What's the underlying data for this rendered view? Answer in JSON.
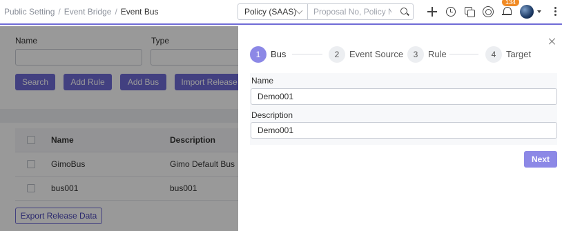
{
  "header": {
    "breadcrumb": [
      "Public Setting",
      "Event Bridge",
      "Event Bus"
    ],
    "breadcrumb_separator": "/",
    "policy_select": {
      "value": "Policy (SAAS)"
    },
    "search": {
      "placeholder": "Proposal No, Policy No, C"
    },
    "icons": [
      "plus-icon",
      "clock-icon",
      "copy-icon",
      "ring-icon",
      "bell-icon",
      "avatar",
      "caret-icon",
      "kebab-icon"
    ],
    "notification_count": "134"
  },
  "filters": {
    "name_label": "Name",
    "type_label": "Type",
    "buttons": [
      "Search",
      "Add Rule",
      "Add Bus",
      "Import Release"
    ]
  },
  "table": {
    "columns": [
      "Name",
      "Description"
    ],
    "rows": [
      {
        "name": "GimoBus",
        "description": "Gimo Default Bus"
      },
      {
        "name": "bus001",
        "description": "bus001"
      }
    ],
    "export_button": "Export Release Data"
  },
  "drawer": {
    "steps": [
      {
        "number": "1",
        "label": "Bus",
        "active": true
      },
      {
        "number": "2",
        "label": "Event Source",
        "active": false
      },
      {
        "number": "3",
        "label": "Rule",
        "active": false
      },
      {
        "number": "4",
        "label": "Target",
        "active": false
      }
    ],
    "name_label": "Name",
    "name_value": "Demo001",
    "description_label": "Description",
    "description_value": "Demo001",
    "next_button": "Next"
  },
  "colors": {
    "accent": "#6f6bd6",
    "accent_light": "#8c88e6",
    "badge": "#f08a24"
  }
}
